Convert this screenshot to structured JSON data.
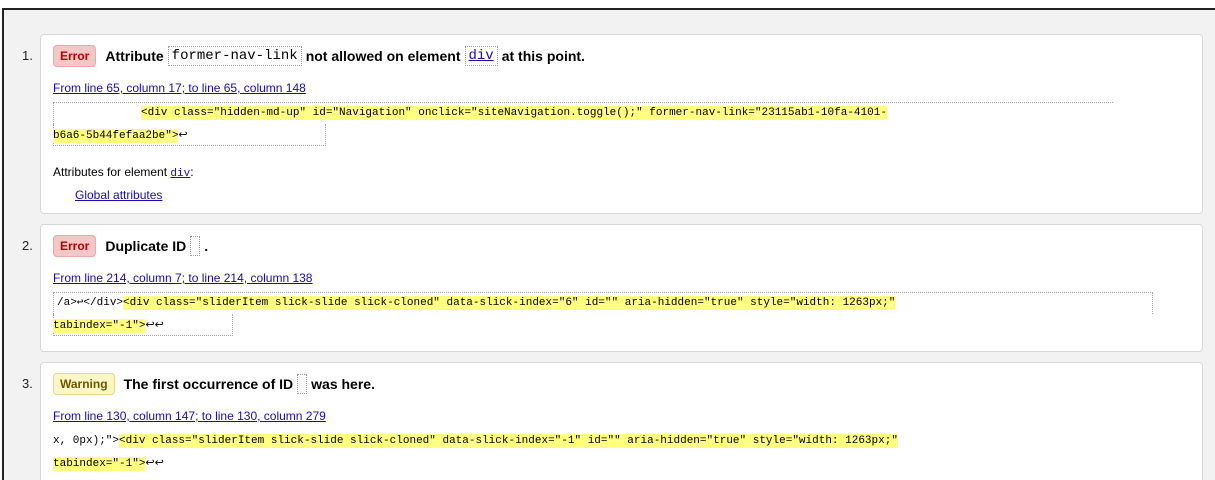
{
  "messages": [
    {
      "number": "1.",
      "badge": "Error",
      "text_before": "Attribute",
      "code_name": "former-nav-link",
      "text_middle": "not allowed on element",
      "code_element": "div",
      "text_after": "at this point.",
      "location": "From line 65, column 17; to line 65, column 148",
      "extract_pre_line1": "",
      "extract_mark_line1": "<div class=\"hidden-md-up\" id=\"Navigation\" onclick=\"siteNavigation.toggle();\" former-nav-link=\"23115ab1-10fa-4101-",
      "extract_mark_line2": "b6a6-5b44fefaa2be\">",
      "return_symbol": "↩",
      "attributes_label": "Attributes for element",
      "attributes_element": "div",
      "attributes_colon": ":",
      "global_link": "Global attributes"
    },
    {
      "number": "2.",
      "badge": "Error",
      "text_before": "Duplicate ID",
      "text_after": ".",
      "location": "From line 214, column 7; to line 214, column 138",
      "extract_pre_line1": "/a>↩</div>",
      "extract_mark_line1": "<div class=\"sliderItem slick-slide slick-cloned\" data-slick-index=\"6\" id=\"\" aria-hidden=\"true\" style=\"width: 1263px;\"",
      "extract_mark_line2": "tabindex=\"-1\">",
      "return_symbols": "↩↩"
    },
    {
      "number": "3.",
      "badge": "Warning",
      "text_before": "The first occurrence of ID",
      "text_after": "was here.",
      "location": "From line 130, column 147; to line 130, column 279",
      "extract_pre_line1": "x, 0px);\">",
      "extract_mark_line1": "<div class=\"sliderItem slick-slide slick-cloned\" data-slick-index=\"-1\" id=\"\" aria-hidden=\"true\" style=\"width: 1263px;\"",
      "extract_mark_line2": "tabindex=\"-1\">",
      "return_symbols": "↩↩"
    }
  ]
}
